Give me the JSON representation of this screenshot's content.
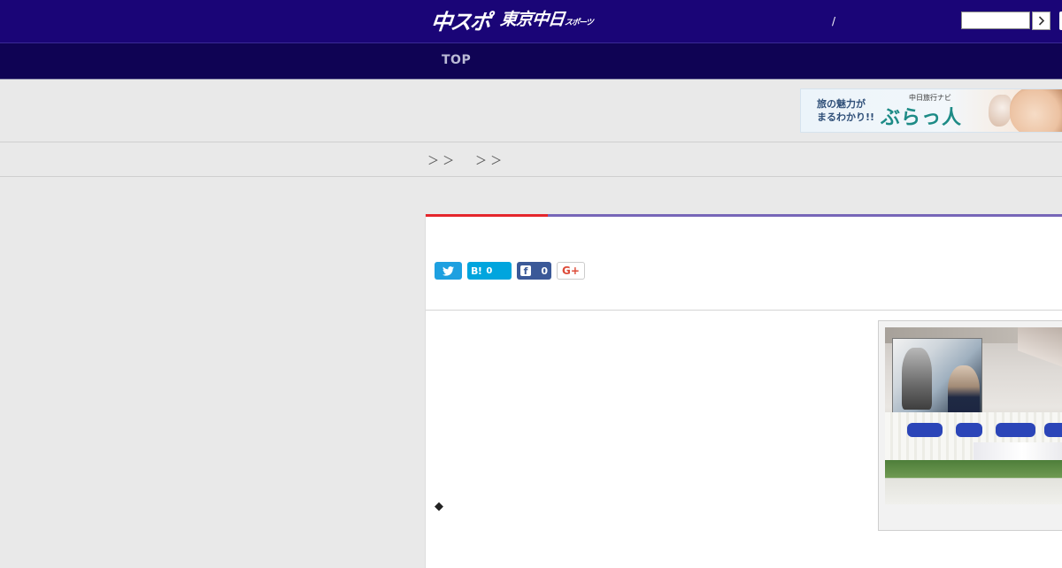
{
  "header": {
    "logo_main": "中スポ",
    "logo_sub": "東京中日",
    "logo_sub_small": "スポーツ",
    "separator": "/",
    "search": {
      "value": "",
      "placeholder": ""
    }
  },
  "nav": {
    "items": [
      {
        "label": "TOP"
      }
    ]
  },
  "ad": {
    "copy_line1": "旅の魅力が",
    "copy_line2": "まるわかり!!",
    "subtitle": "中日旅行ナビ",
    "brand": "ぶらっ人"
  },
  "breadcrumb": {
    "sep1": "＞ ＞",
    "sep2": "＞ ＞"
  },
  "share": {
    "hatena_logo": "B!",
    "hatena_count": "0",
    "facebook_count": "0",
    "googleplus_label": "G+"
  },
  "article": {
    "bullet": "◆"
  },
  "colors": {
    "header_bg": "#1a0577",
    "nav_bg": "#0f0354",
    "accent_red": "#e5262c",
    "accent_purple": "#7766b8",
    "twitter": "#1ea0e0",
    "hatena": "#00a5de",
    "facebook": "#3b5998"
  },
  "icons": {
    "search_button": "chevron-right-icon",
    "twitter": "twitter-bird-icon",
    "facebook": "facebook-icon",
    "googleplus": "google-plus-icon"
  }
}
